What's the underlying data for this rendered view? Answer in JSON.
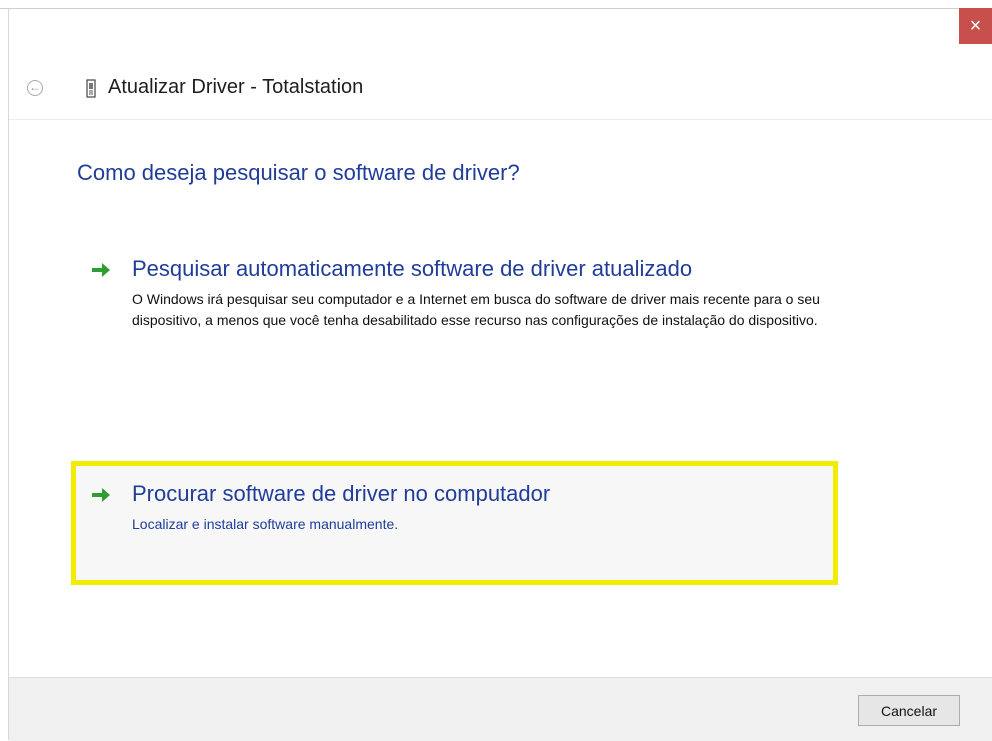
{
  "window": {
    "title": "Atualizar Driver -  Totalstation",
    "close_label": "×"
  },
  "main": {
    "question": "Como deseja pesquisar o software de driver?",
    "options": [
      {
        "title": "Pesquisar automaticamente software de driver atualizado",
        "description": "O Windows irá pesquisar seu computador e a Internet em busca do software de driver mais recente para o seu dispositivo, a menos que você tenha desabilitado esse recurso nas configurações de instalação do dispositivo."
      },
      {
        "title": "Procurar software de driver no computador",
        "description": "Localizar e instalar software manualmente."
      }
    ]
  },
  "footer": {
    "cancel_label": "Cancelar"
  },
  "colors": {
    "link_blue": "#1f3d99",
    "highlight": "#f2ed00",
    "close_red": "#c7504c",
    "arrow_green": "#2f9d2f"
  }
}
